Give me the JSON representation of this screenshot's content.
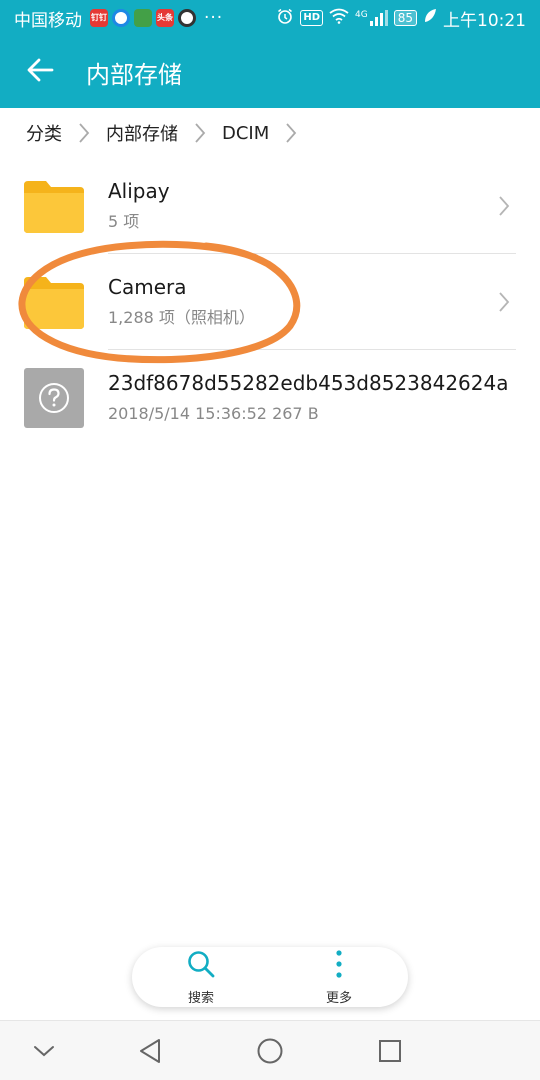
{
  "status_bar": {
    "carrier": "中国移动",
    "app_icons": [
      "钉钉",
      "",
      "",
      "头条",
      ""
    ],
    "more": "···",
    "hd": "HD",
    "network": "4G",
    "battery": "85",
    "time": "上午10:21"
  },
  "app_bar": {
    "title": "内部存储"
  },
  "breadcrumb": {
    "items": [
      "分类",
      "内部存储",
      "DCIM"
    ]
  },
  "files": [
    {
      "name": "Alipay",
      "detail": "5 项",
      "type": "folder"
    },
    {
      "name": "Camera",
      "detail": "1,288 项（照相机）",
      "type": "folder"
    },
    {
      "name": "23df8678d55282edb453d8523842624a",
      "detail": "2018/5/14 15:36:52 267 B",
      "type": "unknown"
    }
  ],
  "bottom_actions": {
    "search_label": "搜索",
    "more_label": "更多"
  },
  "colors": {
    "accent": "#12adc3",
    "folder": "#fbbf24",
    "annotation": "#f08a3c"
  }
}
